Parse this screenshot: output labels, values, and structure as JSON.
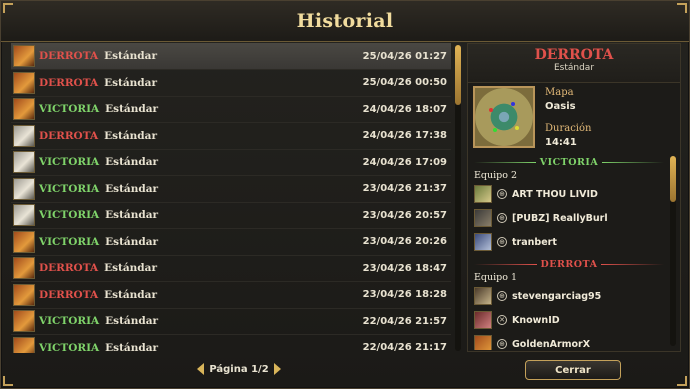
{
  "window": {
    "title": "Historial"
  },
  "matches": [
    {
      "result": "DERROTA",
      "outcome": "loss",
      "mode": "Estándar",
      "date": "25/04/26 01:27",
      "avatar": "a1",
      "selected": true
    },
    {
      "result": "DERROTA",
      "outcome": "loss",
      "mode": "Estándar",
      "date": "25/04/26 00:50",
      "avatar": "a1"
    },
    {
      "result": "VICTORIA",
      "outcome": "win",
      "mode": "Estándar",
      "date": "24/04/26 18:07",
      "avatar": "a1"
    },
    {
      "result": "DERROTA",
      "outcome": "loss",
      "mode": "Estándar",
      "date": "24/04/26 17:38",
      "avatar": "a3"
    },
    {
      "result": "VICTORIA",
      "outcome": "win",
      "mode": "Estándar",
      "date": "24/04/26 17:09",
      "avatar": "a3"
    },
    {
      "result": "VICTORIA",
      "outcome": "win",
      "mode": "Estándar",
      "date": "23/04/26 21:37",
      "avatar": "a3"
    },
    {
      "result": "VICTORIA",
      "outcome": "win",
      "mode": "Estándar",
      "date": "23/04/26 20:57",
      "avatar": "a3"
    },
    {
      "result": "VICTORIA",
      "outcome": "win",
      "mode": "Estándar",
      "date": "23/04/26 20:26",
      "avatar": "a1"
    },
    {
      "result": "DERROTA",
      "outcome": "loss",
      "mode": "Estándar",
      "date": "23/04/26 18:47",
      "avatar": "a1"
    },
    {
      "result": "DERROTA",
      "outcome": "loss",
      "mode": "Estándar",
      "date": "23/04/26 18:28",
      "avatar": "a1"
    },
    {
      "result": "VICTORIA",
      "outcome": "win",
      "mode": "Estándar",
      "date": "22/04/26 21:57",
      "avatar": "a1"
    },
    {
      "result": "VICTORIA",
      "outcome": "win",
      "mode": "Estándar",
      "date": "22/04/26 21:17",
      "avatar": "a1"
    }
  ],
  "pager": {
    "label": "Página 1/2"
  },
  "detail": {
    "result": "DERROTA",
    "mode": "Estándar",
    "map_label": "Mapa",
    "map_name": "Oasis",
    "duration_label": "Duración",
    "duration": "14:41",
    "teams": [
      {
        "separator": "VICTORIA",
        "outcome": "win",
        "name": "Equipo 2",
        "players": [
          {
            "name": "ART THOU LIVID",
            "avatar": "p1",
            "platform": "globe-icon"
          },
          {
            "name": "[PUBZ] ReallyBurl",
            "avatar": "p2",
            "platform": "globe-icon"
          },
          {
            "name": "tranbert",
            "avatar": "p3",
            "platform": "globe-icon"
          }
        ]
      },
      {
        "separator": "DERROTA",
        "outcome": "loss",
        "name": "Equipo 1",
        "players": [
          {
            "name": "stevengarciag95",
            "avatar": "p4",
            "platform": "globe-icon"
          },
          {
            "name": "KnownID",
            "avatar": "p5",
            "platform": "xbox-icon"
          },
          {
            "name": "GoldenArmorX",
            "avatar": "p6",
            "platform": "globe-icon"
          }
        ]
      }
    ]
  },
  "buttons": {
    "close": "Cerrar"
  },
  "colors": {
    "loss": "#e0514b",
    "win": "#7fd36a",
    "title": "#f1dc9e",
    "accent": "#c4a15a"
  }
}
